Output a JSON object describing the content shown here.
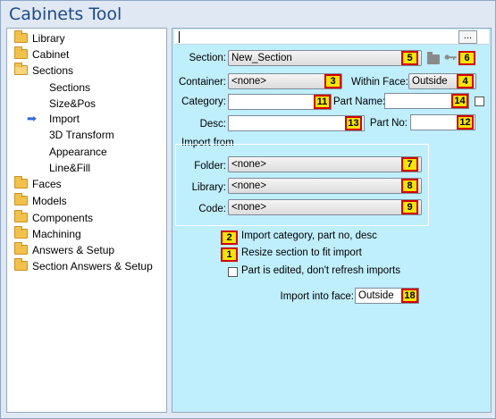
{
  "window": {
    "title": "Cabinets Tool"
  },
  "tree": {
    "items": [
      {
        "label": "Library",
        "icon": "folder-icon"
      },
      {
        "label": "Cabinet",
        "icon": "folder-icon"
      },
      {
        "label": "Sections",
        "icon": "folder-open-icon"
      },
      {
        "label": "Sections"
      },
      {
        "label": "Size&Pos"
      },
      {
        "label": "Import",
        "selected": true
      },
      {
        "label": "3D Transform"
      },
      {
        "label": "Appearance"
      },
      {
        "label": "Line&Fill"
      },
      {
        "label": "Faces",
        "icon": "folder-icon"
      },
      {
        "label": "Models",
        "icon": "folder-icon"
      },
      {
        "label": "Components",
        "icon": "folder-icon"
      },
      {
        "label": "Machining",
        "icon": "folder-icon"
      },
      {
        "label": "Answers & Setup",
        "icon": "folder-icon"
      },
      {
        "label": "Section Answers & Setup",
        "icon": "folder-icon"
      }
    ]
  },
  "panel": {
    "ellipsis_label": "...",
    "section": {
      "label": "Section:",
      "value": "New_Section",
      "badge": "5",
      "icon_badge": "6"
    },
    "container": {
      "label": "Container:",
      "value": "<none>",
      "badge": "3"
    },
    "within_face": {
      "label": "Within Face:",
      "value": "Outside",
      "badge": "4"
    },
    "category": {
      "label": "Category:",
      "value": "",
      "badge": "11"
    },
    "part_name": {
      "label": "Part Name:",
      "value": "",
      "badge": "14"
    },
    "desc": {
      "label": "Desc:",
      "value": "",
      "badge": "13"
    },
    "part_no": {
      "label": "Part No:",
      "value": "",
      "badge": "12"
    },
    "import_from": {
      "title": "Import from",
      "folder": {
        "label": "Folder:",
        "value": "<none>",
        "badge": "7"
      },
      "library": {
        "label": "Library:",
        "value": "<none>",
        "badge": "8"
      },
      "code": {
        "label": "Code:",
        "value": "<none>",
        "badge": "9"
      }
    },
    "options": [
      {
        "badge": "2",
        "label": "Import category, part no, desc"
      },
      {
        "badge": "1",
        "label": "Resize section to fit import"
      },
      {
        "label": "Part is edited, don't refresh imports",
        "checked": false
      }
    ],
    "import_into_face": {
      "label": "Import into face:",
      "value": "Outside",
      "badge": "18"
    }
  },
  "colors": {
    "panel_bg": "#bfeefd",
    "badge_fill": "#f6e500",
    "badge_border": "#d10000",
    "title": "#1f4a8a"
  }
}
